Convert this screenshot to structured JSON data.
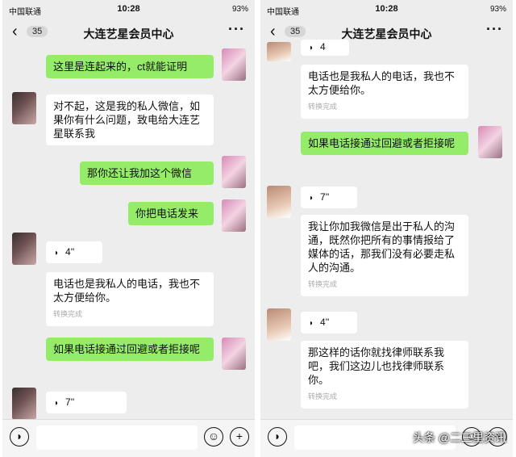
{
  "status": {
    "carrier": "中国联通",
    "time": "10:28",
    "battery": "93%"
  },
  "nav": {
    "badge": "35",
    "title": "大连艺星会员中心"
  },
  "left": {
    "m1": "这里是连起来的，ct就能证明",
    "m2": "对不起，这是我的私人微信，如果你有什么问题，致电给大连艺星联系我",
    "m3": "那你还让我加这个微信",
    "m4": "你把电话发来",
    "v1": "4''",
    "m5": "电话也是我私人的电话，我也不太方便给你。",
    "m5_status": "转换完成",
    "m6": "如果电话接通过回避或者拒接呢",
    "v2": "7''"
  },
  "right": {
    "v0": "4",
    "m1": "电话也是我私人的电话，我也不太方便给你。",
    "m1_status": "转换完成",
    "m2": "如果电话接通过回避或者拒接呢",
    "v1": "7''",
    "m3": "我让你加我微信是出于私人的沟通，既然你把所有的事情报给了媒体的话，那我们没有必要走私人的沟通。",
    "m3_status": "转换完成",
    "v2": "4''",
    "m4": "那这样的话你就找律师联系我吧，我们这边儿也找律师联系你。",
    "m4_status": "转换完成"
  },
  "watermark": "头条 @二三里资讯"
}
